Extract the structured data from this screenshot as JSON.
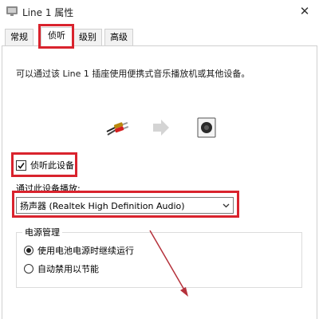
{
  "window": {
    "title": "Line 1 属性",
    "close_glyph": "✕",
    "icon": "speaker-app-icon"
  },
  "tabs": [
    {
      "label": "常规",
      "active": false
    },
    {
      "label": "侦听",
      "active": true
    },
    {
      "label": "级别",
      "active": false
    },
    {
      "label": "高级",
      "active": false
    }
  ],
  "listen": {
    "description": "可以通过该 Line 1 插座使用便携式音乐播放机或其他设备。",
    "flow_icons": [
      "audio-cable-icon",
      "arrow-right-icon",
      "speaker-icon"
    ],
    "checkbox_label": "侦听此设备",
    "checkbox_checked": true,
    "playback_label": "通过此设备播放:",
    "playback_device": "扬声器 (Realtek High Definition Audio)"
  },
  "power": {
    "legend": "电源管理",
    "options": [
      {
        "label": "使用电池电源时继续运行",
        "checked": true
      },
      {
        "label": "自动禁用以节能",
        "checked": false
      }
    ]
  },
  "colors": {
    "highlight": "#d9232d",
    "annotation_arrow": "#b5313b"
  }
}
